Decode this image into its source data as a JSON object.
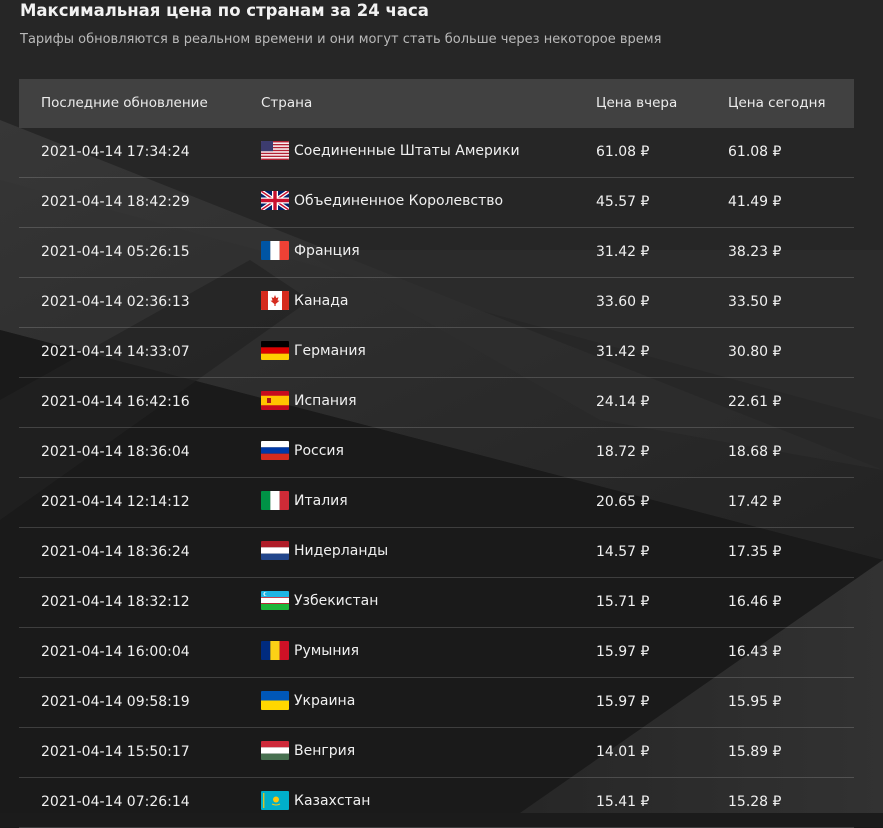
{
  "header": {
    "title": "Максимальная цена по странам за 24 часа",
    "subtitle": "Тарифы обновляются в реальном времени и они могут стать больше через некоторое время"
  },
  "table": {
    "columns": [
      "Последние обновление",
      "Страна",
      "Цена вчера",
      "Цена сегодня"
    ],
    "rows": [
      {
        "updated": "2021-04-14 17:34:24",
        "country": "Соединенные Штаты Америки",
        "flag": "us-flag-icon",
        "yesterday": "61.08 ₽",
        "today": "61.08 ₽"
      },
      {
        "updated": "2021-04-14 18:42:29",
        "country": "Объединенное Королевство",
        "flag": "gb-flag-icon",
        "yesterday": "45.57 ₽",
        "today": "41.49 ₽"
      },
      {
        "updated": "2021-04-14 05:26:15",
        "country": "Франция",
        "flag": "fr-flag-icon",
        "yesterday": "31.42 ₽",
        "today": "38.23 ₽"
      },
      {
        "updated": "2021-04-14 02:36:13",
        "country": "Канада",
        "flag": "ca-flag-icon",
        "yesterday": "33.60 ₽",
        "today": "33.50 ₽"
      },
      {
        "updated": "2021-04-14 14:33:07",
        "country": "Германия",
        "flag": "de-flag-icon",
        "yesterday": "31.42 ₽",
        "today": "30.80 ₽"
      },
      {
        "updated": "2021-04-14 16:42:16",
        "country": "Испания",
        "flag": "es-flag-icon",
        "yesterday": "24.14 ₽",
        "today": "22.61 ₽"
      },
      {
        "updated": "2021-04-14 18:36:04",
        "country": "Россия",
        "flag": "ru-flag-icon",
        "yesterday": "18.72 ₽",
        "today": "18.68 ₽"
      },
      {
        "updated": "2021-04-14 12:14:12",
        "country": "Италия",
        "flag": "it-flag-icon",
        "yesterday": "20.65 ₽",
        "today": "17.42 ₽"
      },
      {
        "updated": "2021-04-14 18:36:24",
        "country": "Нидерланды",
        "flag": "nl-flag-icon",
        "yesterday": "14.57 ₽",
        "today": "17.35 ₽"
      },
      {
        "updated": "2021-04-14 18:32:12",
        "country": "Узбекистан",
        "flag": "uz-flag-icon",
        "yesterday": "15.71 ₽",
        "today": "16.46 ₽"
      },
      {
        "updated": "2021-04-14 16:00:04",
        "country": "Румыния",
        "flag": "ro-flag-icon",
        "yesterday": "15.97 ₽",
        "today": "16.43 ₽"
      },
      {
        "updated": "2021-04-14 09:58:19",
        "country": "Украина",
        "flag": "ua-flag-icon",
        "yesterday": "15.97 ₽",
        "today": "15.95 ₽"
      },
      {
        "updated": "2021-04-14 15:50:17",
        "country": "Венгрия",
        "flag": "hu-flag-icon",
        "yesterday": "14.01 ₽",
        "today": "15.89 ₽"
      },
      {
        "updated": "2021-04-14 07:26:14",
        "country": "Казахстан",
        "flag": "kz-flag-icon",
        "yesterday": "15.41 ₽",
        "today": "15.28 ₽"
      }
    ]
  },
  "colors": {
    "background": "#1b1b1b",
    "header_row": "#484848",
    "text": "#f0f0f0"
  }
}
